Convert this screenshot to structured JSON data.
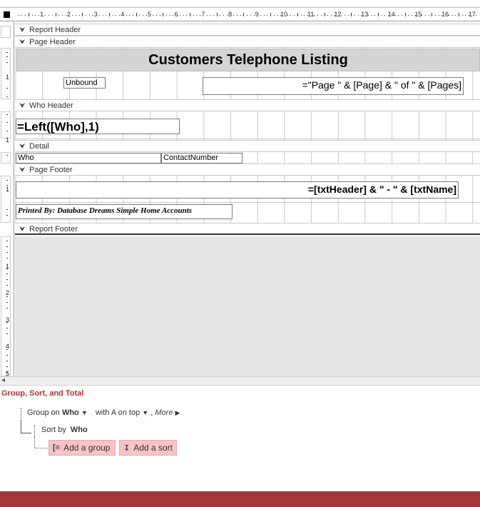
{
  "ruler": {
    "numbers": [
      "1",
      "2",
      "3",
      "4",
      "5",
      "6",
      "7",
      "8",
      "9",
      "10",
      "11",
      "12",
      "13",
      "14",
      "15",
      "16",
      "17"
    ],
    "vertical_numbers": [
      "1",
      "1",
      "1",
      "1",
      "2",
      "3",
      "4",
      "5"
    ]
  },
  "bands": {
    "report_header": "Report Header",
    "page_header": "Page Header",
    "who_header": "Who Header",
    "detail": "Detail",
    "page_footer": "Page Footer",
    "report_footer": "Report Footer"
  },
  "controls": {
    "title": "Customers Telephone Listing",
    "unbound": "Unbound",
    "page_expr": "=\"Page \" & [Page] & \" of  \" & [Pages]",
    "who_expr": "=Left([Who],1)",
    "who_field": "Who",
    "contact_field": "ContactNumber",
    "footer_expr": "=[txtHeader] & \" - \" & [txtName]",
    "printed_by": "Printed By: Database Dreams Simple Home Accounts"
  },
  "gst": {
    "title": "Group, Sort, and Total",
    "group_on_prefix": "Group on",
    "group_on_field": "Who",
    "with_a_on_top": "with A on top",
    "more": "More",
    "sort_by_prefix": "Sort by",
    "sort_by_field": "Who",
    "add_group": "Add a group",
    "add_sort": "Add a sort"
  },
  "colors": {
    "accent": "#a4373a",
    "gst_title": "#b03030",
    "add_button_bg": "#f7c4c4",
    "title_box_bg": "#d4d4d4"
  }
}
